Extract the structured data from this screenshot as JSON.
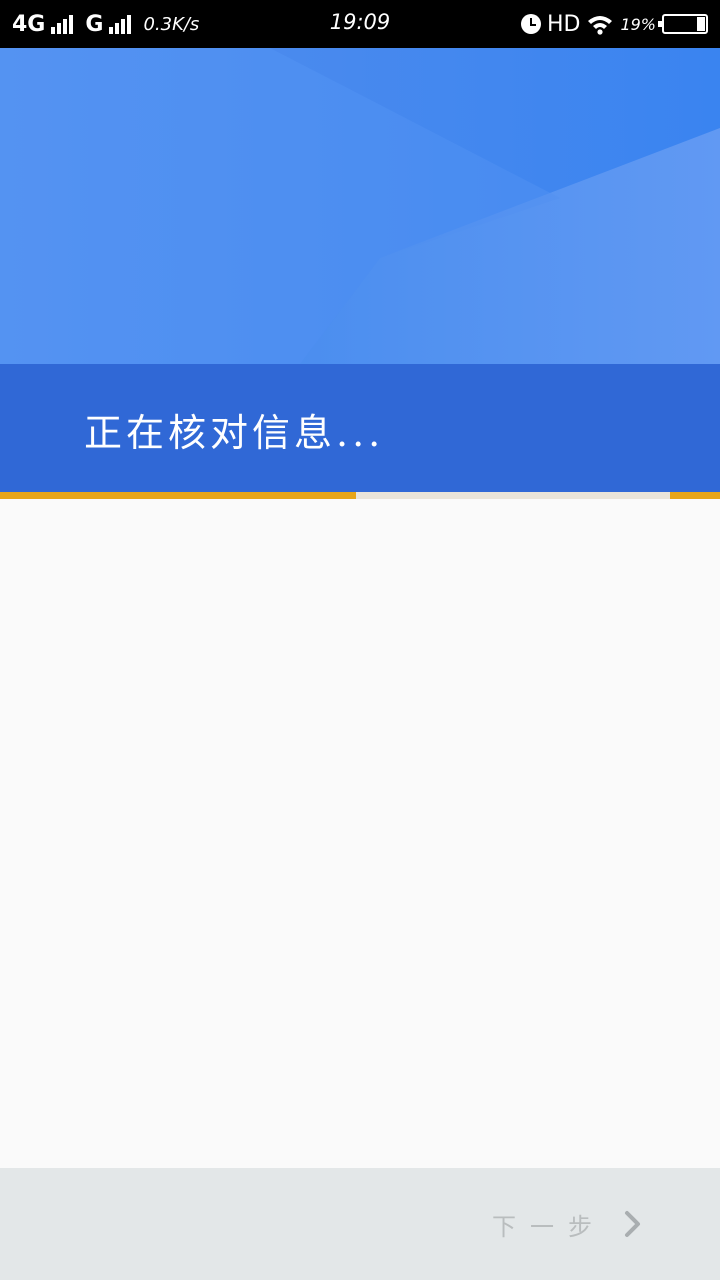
{
  "status_bar": {
    "network_1": "4G",
    "network_2": "G",
    "speed": "0.3K/s",
    "time": "19:09",
    "hd": "HD",
    "battery_pct": "19%",
    "battery_level": 0.19
  },
  "header": {
    "title": "正在核对信息..."
  },
  "progress": {
    "segments": [
      {
        "start": 0.0,
        "end": 0.494
      },
      {
        "start": 0.931,
        "end": 1.0
      }
    ]
  },
  "footer": {
    "next_label": "下一步"
  },
  "colors": {
    "header_light": "#4a8cf1",
    "header_band": "#3068d6",
    "progress_accent": "#e6a51a",
    "footer_bg": "#e3e7e8",
    "disabled_text": "#b9bdbe"
  },
  "icons": {
    "alarm": "alarm-icon",
    "wifi": "wifi-icon",
    "battery": "battery-icon",
    "next": "chevron-right-icon"
  }
}
